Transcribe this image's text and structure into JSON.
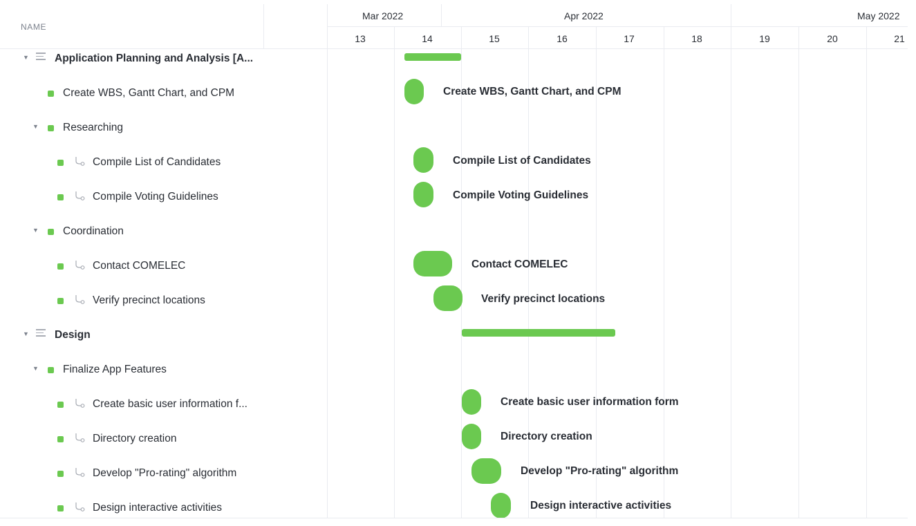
{
  "header": {
    "name_column": "NAME"
  },
  "timeline": {
    "months": [
      "Mar 2022",
      "Apr 2022",
      "May 2022"
    ],
    "days": [
      "13",
      "14",
      "15",
      "16",
      "17",
      "18",
      "19",
      "20",
      "21"
    ]
  },
  "rows": [
    {
      "name": "Application Planning and Analysis [A...",
      "kind": "list",
      "bar_label": ""
    },
    {
      "name": "Create WBS, Gantt Chart, and CPM",
      "kind": "task",
      "bar_label": "Create WBS, Gantt Chart, and CPM"
    },
    {
      "name": "Researching",
      "kind": "group",
      "bar_label": ""
    },
    {
      "name": "Compile List of Candidates",
      "kind": "subtask",
      "bar_label": "Compile List of Candidates"
    },
    {
      "name": "Compile Voting Guidelines",
      "kind": "subtask",
      "bar_label": "Compile Voting Guidelines"
    },
    {
      "name": "Coordination",
      "kind": "group",
      "bar_label": ""
    },
    {
      "name": "Contact COMELEC",
      "kind": "subtask",
      "bar_label": "Contact COMELEC"
    },
    {
      "name": "Verify precinct locations",
      "kind": "subtask",
      "bar_label": "Verify precinct locations"
    },
    {
      "name": "Design",
      "kind": "list",
      "bar_label": ""
    },
    {
      "name": "Finalize App Features",
      "kind": "group",
      "bar_label": ""
    },
    {
      "name": "Create basic user information f...",
      "kind": "subtask",
      "bar_label": "Create basic user information form"
    },
    {
      "name": "Directory creation",
      "kind": "subtask",
      "bar_label": "Directory creation"
    },
    {
      "name": "Develop \"Pro-rating\" algorithm",
      "kind": "subtask",
      "bar_label": "Develop \"Pro-rating\" algorithm"
    },
    {
      "name": "Design interactive activities",
      "kind": "subtask",
      "bar_label": "Design interactive activities"
    }
  ],
  "colors": {
    "bar": "#6bc950",
    "status_dot": "#6bc950",
    "grid": "#e9ebf0"
  },
  "icons": {
    "list": "list-icon",
    "dependency": "dependency-icon",
    "caret": "caret-down-icon"
  }
}
